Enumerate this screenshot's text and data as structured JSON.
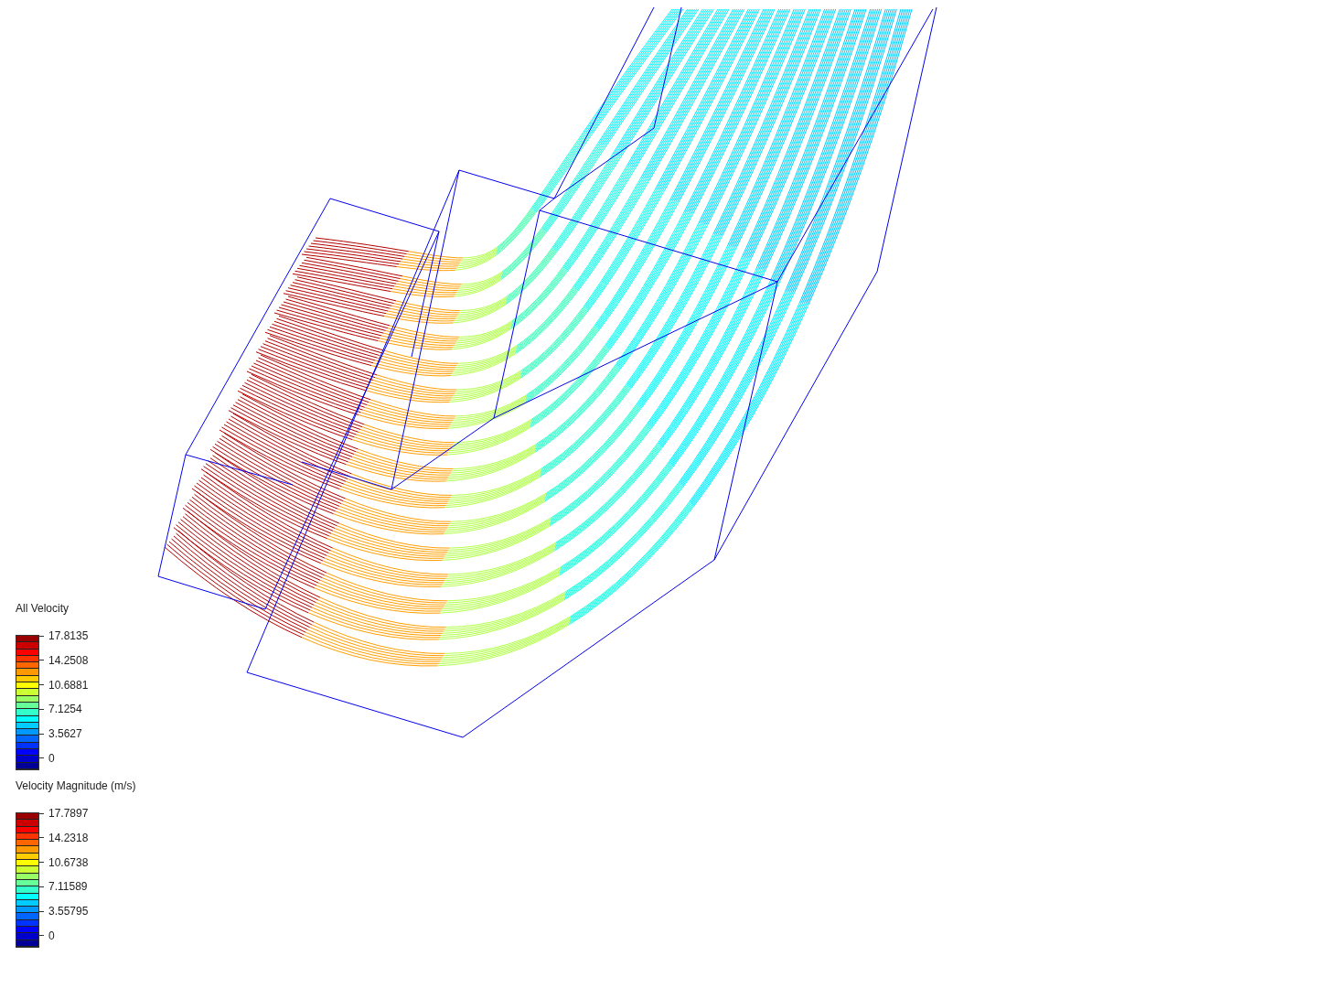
{
  "legends": [
    {
      "title": "All Velocity",
      "ticks": [
        "17.8135",
        "14.2508",
        "10.6881",
        "7.1254",
        "3.5627",
        "0"
      ]
    },
    {
      "title": "Velocity Magnitude (m/s)",
      "ticks": [
        "17.7897",
        "14.2318",
        "10.6738",
        "7.11589",
        "3.55795",
        "0"
      ]
    }
  ]
}
